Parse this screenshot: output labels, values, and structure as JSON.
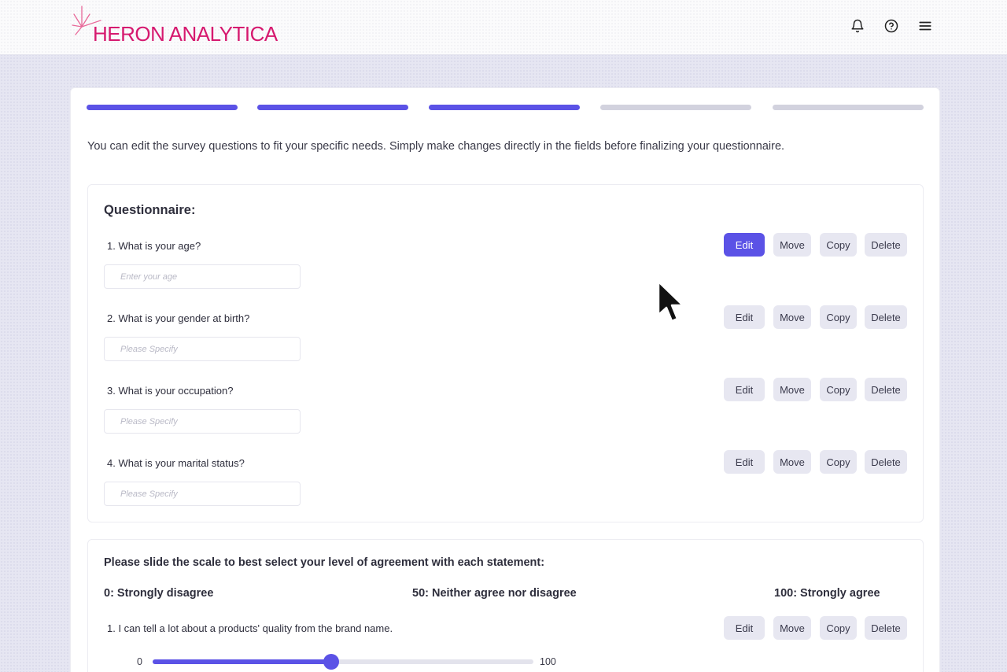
{
  "brand": {
    "name": "HERON ANALYTICA",
    "color": "#d6196f"
  },
  "header": {
    "icons": [
      "bell-icon",
      "help-circle-icon",
      "menu-icon"
    ]
  },
  "progress": {
    "total_steps": 5,
    "completed_steps": 3,
    "accent": "#5b52e6"
  },
  "intro_text": "You can edit the survey questions to fit your specific needs. Simply make changes directly in the fields before finalizing your questionnaire.",
  "questionnaire": {
    "title": "Questionnaire:",
    "actions": {
      "edit": "Edit",
      "move": "Move",
      "copy": "Copy",
      "delete": "Delete"
    },
    "questions": [
      {
        "label": "1. What is your age?",
        "placeholder": "Enter your age",
        "active": true
      },
      {
        "label": "2. What is your gender at birth?",
        "placeholder": "Please Specify",
        "active": false
      },
      {
        "label": "3. What is your occupation?",
        "placeholder": "Please Specify",
        "active": false
      },
      {
        "label": "4. What is your marital status?",
        "placeholder": "Please Specify",
        "active": false
      }
    ]
  },
  "agreement": {
    "title": "Please slide the scale to best select your level of agreement with each statement:",
    "scale": {
      "low": "0: Strongly disagree",
      "mid": "50: Neither agree nor disagree",
      "high": "100: Strongly agree"
    },
    "statements": [
      {
        "label": "1. I can tell a lot about a products' quality from the brand name.",
        "min": "0",
        "max": "100",
        "value": 47
      }
    ]
  }
}
